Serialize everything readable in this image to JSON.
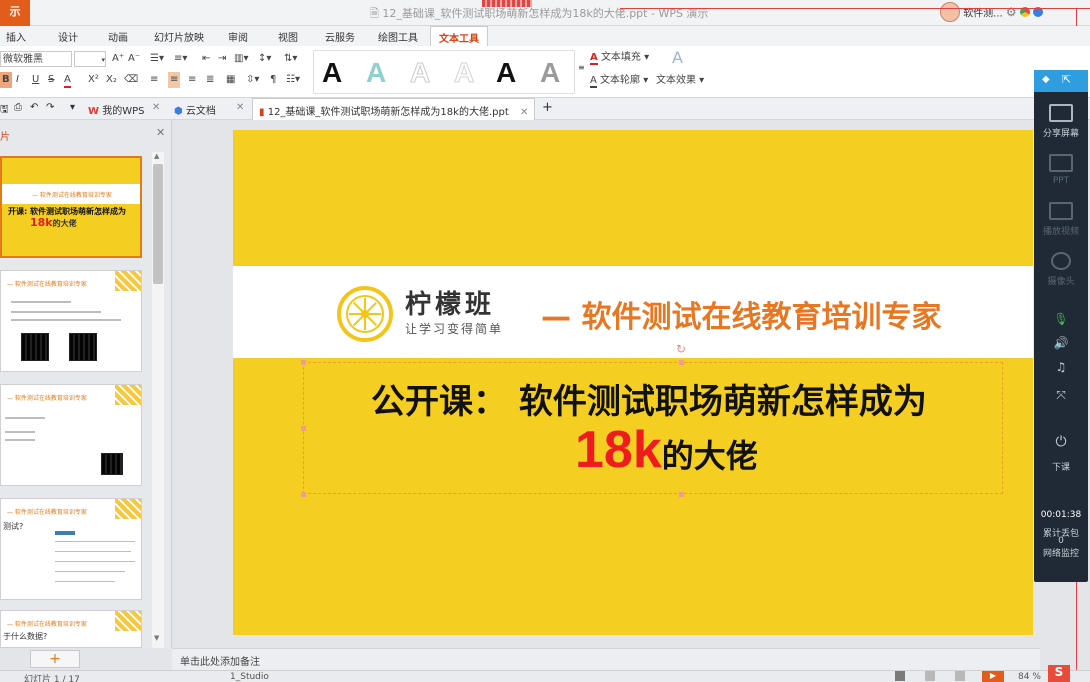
{
  "app": {
    "button_label": "示",
    "title": "12_基础课_软件测试职场萌新怎样成为18k的大佬.ppt - WPS 演示",
    "user_name": "软件测..."
  },
  "menu_tabs": [
    {
      "label": "插入"
    },
    {
      "label": "设计"
    },
    {
      "label": "动画"
    },
    {
      "label": "幻灯片放映"
    },
    {
      "label": "审阅"
    },
    {
      "label": "视图"
    },
    {
      "label": "云服务"
    },
    {
      "label": "绘图工具"
    },
    {
      "label": "文本工具"
    }
  ],
  "active_tab": "文本工具",
  "ribbon": {
    "font_name": "微软雅黑",
    "font_size": "",
    "text_fill_label": "文本填充",
    "text_outline_label": "文本轮廓",
    "text_effect_label": "文本效果",
    "style_letters": [
      "A",
      "A",
      "A",
      "A",
      "A",
      "A"
    ]
  },
  "quickbar": {
    "my_wps": "我的WPS",
    "cloud_docs": "云文档",
    "doc_tab": "12_基础课_软件测试职场萌新怎样成为18k的大佬.ppt"
  },
  "panel": {
    "title": "片"
  },
  "thumbnails": [
    {
      "header": "— 软件测试在线教育培训专家",
      "line1": "开课: 软件测试职场萌新怎样成为",
      "line2a": "18k",
      "line2b": "的大佬"
    },
    {
      "header": "— 软件测试在线教育培训专家"
    },
    {
      "header": "— 软件测试在线教育培训专家"
    },
    {
      "header": "— 软件测试在线教育培训专家",
      "sub": "测试?"
    },
    {
      "header": "— 软件测试在线教育培训专家",
      "sub": "于什么数据?"
    }
  ],
  "slide": {
    "logo_name": "柠檬班",
    "logo_sub": "让学习变得简单",
    "tagline": "— 软件测试在线教育培训专家",
    "title_line1": "公开课： 软件测试职场萌新怎样成为",
    "title_big": "18k",
    "title_rest": "的大佬"
  },
  "notes_placeholder": "单击此处添加备注",
  "status": {
    "slide_counter": "幻灯片 1 / 17",
    "theme": "1_Studio",
    "zoom": "84 %"
  },
  "live_panel": {
    "share_screen": "分享屏幕",
    "ppt": "PPT",
    "play_video": "播放视频",
    "camera": "摄像头",
    "end_class": "下课",
    "timer": "00:01:38",
    "count_label": "累计丢包",
    "count_value": "0",
    "network": "网络监控"
  },
  "colors": {
    "accent": "#e25c1b",
    "slide_bg": "#f5ce22",
    "tagline": "#e87722",
    "highlight": "#ee1c1c",
    "live_bg": "#1f2a36"
  }
}
